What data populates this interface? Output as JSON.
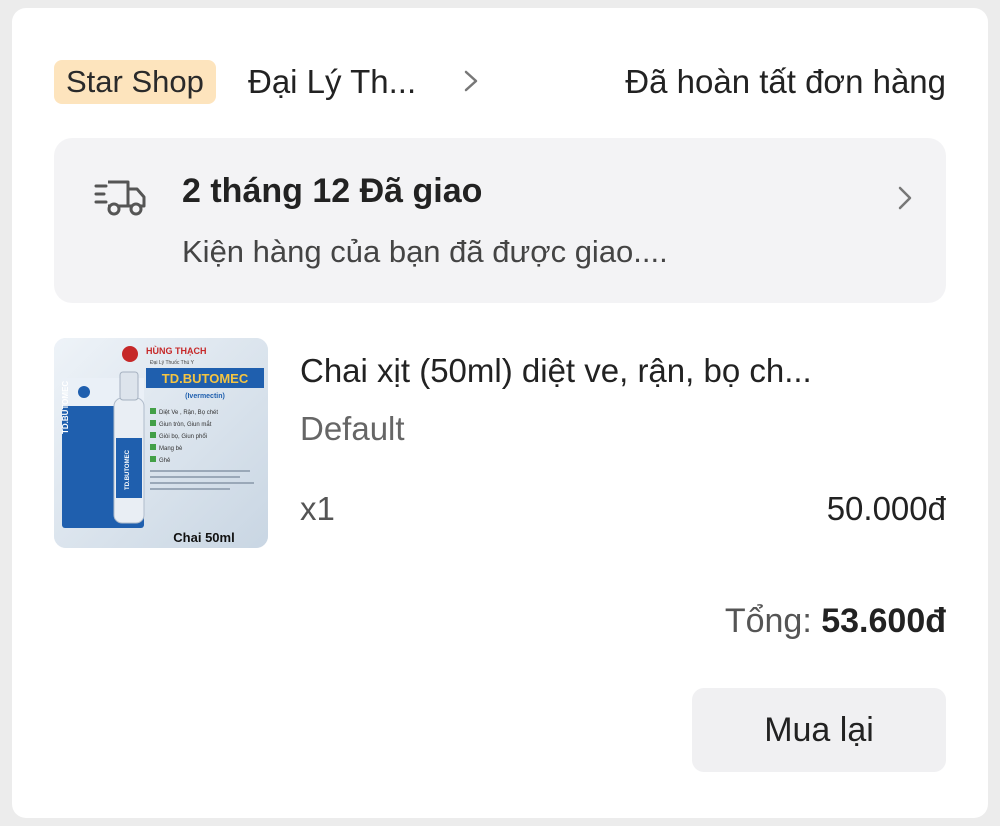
{
  "header": {
    "shop_badge": "Star Shop",
    "shop_name": "Đại Lý Th...",
    "chevron_icon": "chevron-right-icon",
    "order_status": "Đã hoàn tất đơn hàng"
  },
  "delivery": {
    "icon": "truck-icon",
    "title": "2 tháng 12 Đã giao",
    "subtitle": "Kiện hàng của bạn đã được giao....",
    "chevron_icon": "chevron-right-icon"
  },
  "product": {
    "image": {
      "brand": "HÙNG THẠCH",
      "brand_sub": "Đại Lý Thuốc Thú Y",
      "product_title": "TD.BUTOMEC",
      "ingredient": "(Ivermectin)",
      "bottle_label": "TD.BUTOMEC",
      "features": [
        "Diệt Ve , Rận, Bọ chét",
        "Giun tròn, Giun mắt",
        "Giòi bọ, Giun phổi",
        "Mang bè",
        "Ghẻ"
      ],
      "size_caption": "Chai 50ml"
    },
    "name": "Chai xịt (50ml) diệt ve, rận, bọ ch...",
    "variant": "Default",
    "quantity": "x1",
    "price": "50.000đ"
  },
  "total": {
    "label": "Tổng:",
    "value": "53.600đ"
  },
  "actions": {
    "buy_again": "Mua lại"
  },
  "colors": {
    "badge_bg": "#fde4bd",
    "panel_bg": "#f3f3f5",
    "product_accent": "#1f5fae"
  }
}
